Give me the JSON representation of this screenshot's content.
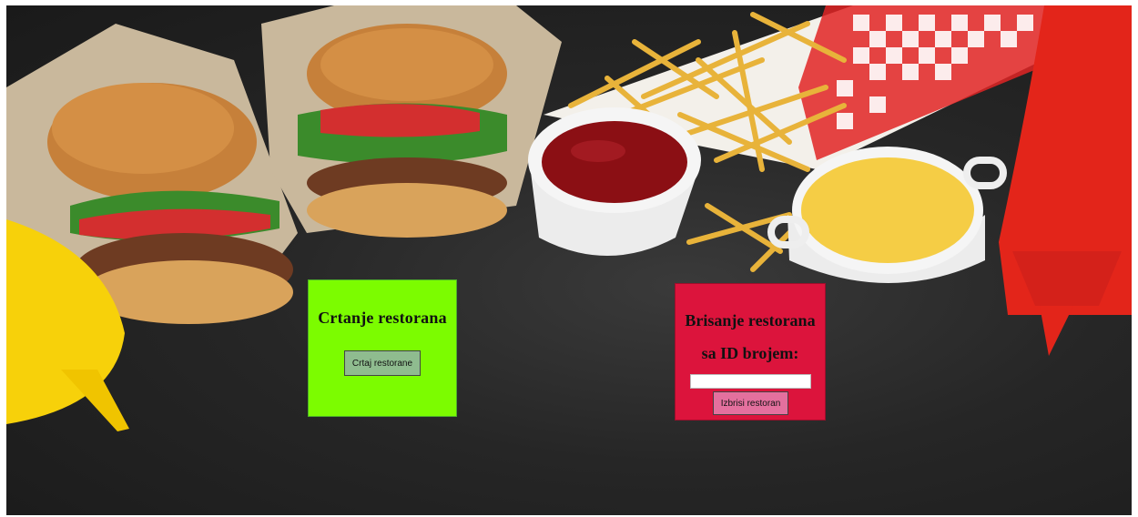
{
  "background": {
    "image": "burgers-fries-sauces-photo",
    "colors": {
      "board": "#262626",
      "ketchup": "#8b0f14",
      "mustard": "#f5cd45",
      "bottle_red": "#e3251a",
      "bottle_yellow": "#f7d10a"
    }
  },
  "draw_panel": {
    "heading": "Crtanje restorana",
    "button_label": "Crtaj restorane",
    "bg_color": "#7cfc00",
    "button_color": "#8fbc8f"
  },
  "delete_panel": {
    "heading_line1": "Brisanje restorana",
    "heading_line2": "sa ID brojem:",
    "id_input_value": "",
    "button_label": "Izbrisi restoran",
    "bg_color": "#dc143c",
    "button_color": "#e4709e"
  }
}
